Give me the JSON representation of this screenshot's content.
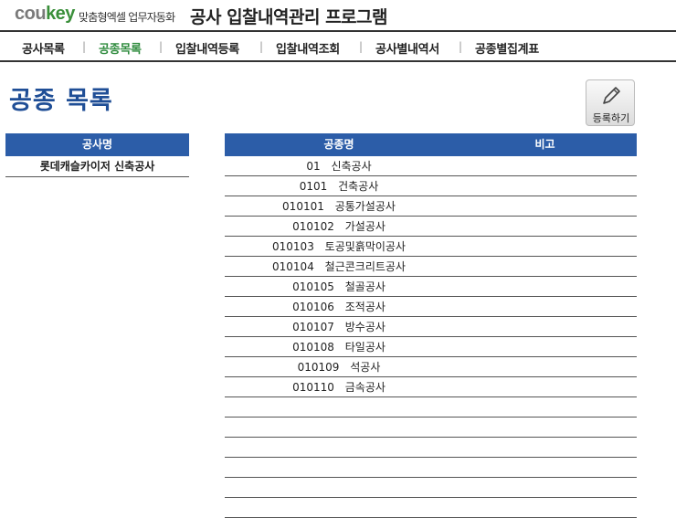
{
  "header": {
    "logo_part1": "cou",
    "logo_part2": "key",
    "logo_subtitle": "맞춤형엑셀 업무자동화",
    "app_title": "공사 입찰내역관리 프로그램"
  },
  "nav": {
    "items": [
      {
        "label": "공사목록",
        "active": false
      },
      {
        "label": "공종목록",
        "active": true
      },
      {
        "label": "입찰내역등록",
        "active": false
      },
      {
        "label": "입찰내역조회",
        "active": false
      },
      {
        "label": "공사별내역서",
        "active": false
      },
      {
        "label": "공종별집계표",
        "active": false
      }
    ],
    "separator": "|"
  },
  "page": {
    "title": "공종 목록",
    "register_button_label": "등록하기",
    "register_button_icon": "pencil-icon"
  },
  "project_table": {
    "header": "공사명",
    "rows": [
      "롯데캐슬카이저 신축공사"
    ]
  },
  "work_type_table": {
    "headers": {
      "name": "공종명",
      "note": "비고"
    },
    "rows": [
      {
        "code": "01",
        "name": "신축공사",
        "note": ""
      },
      {
        "code": "0101",
        "name": "건축공사",
        "note": ""
      },
      {
        "code": "010101",
        "name": "공통가설공사",
        "note": ""
      },
      {
        "code": "010102",
        "name": "가설공사",
        "note": ""
      },
      {
        "code": "010103",
        "name": "토공및흙막이공사",
        "note": ""
      },
      {
        "code": "010104",
        "name": "철근콘크리트공사",
        "note": ""
      },
      {
        "code": "010105",
        "name": "철골공사",
        "note": ""
      },
      {
        "code": "010106",
        "name": "조적공사",
        "note": ""
      },
      {
        "code": "010107",
        "name": "방수공사",
        "note": ""
      },
      {
        "code": "010108",
        "name": "타일공사",
        "note": ""
      },
      {
        "code": "010109",
        "name": "석공사",
        "note": ""
      },
      {
        "code": "010110",
        "name": "금속공사",
        "note": ""
      },
      {
        "code": "",
        "name": "",
        "note": ""
      },
      {
        "code": "",
        "name": "",
        "note": ""
      },
      {
        "code": "",
        "name": "",
        "note": ""
      },
      {
        "code": "",
        "name": "",
        "note": ""
      },
      {
        "code": "",
        "name": "",
        "note": ""
      },
      {
        "code": "",
        "name": "",
        "note": ""
      }
    ]
  },
  "colors": {
    "accent_blue": "#2c5da8",
    "title_blue": "#1f4e96",
    "active_green": "#2e8b3d",
    "logo_green": "#3a8f3a"
  }
}
